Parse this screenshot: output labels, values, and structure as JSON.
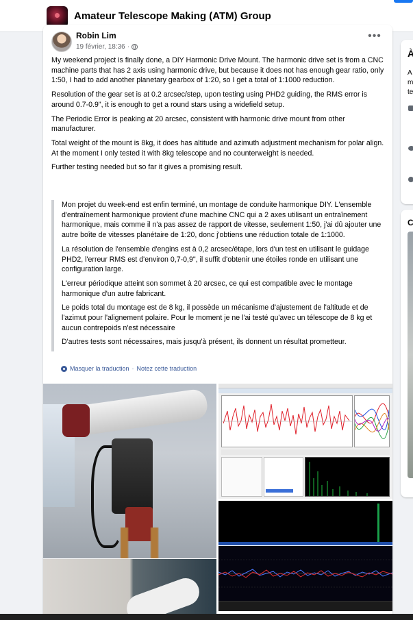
{
  "header": {
    "group_title": "Amateur Telescope Making (ATM) Group"
  },
  "post": {
    "author": "Robin Lim",
    "timestamp": "19 février, 18:36",
    "separator": "·",
    "more_label": "•••",
    "paragraphs": [
      "My weekend project is finally done, a DIY Harmonic Drive Mount. The harmonic drive set is from a CNC machine parts that has 2 axis using harmonic drive, but because it does not has enough gear ratio, only 1:50, I had to add another planetary gearbox of 1:20, so I get a total of 1:1000 reduction.",
      "Resolution of the gear set is at 0.2 arcsec/step, upon testing using PHD2 guiding, the RMS error is around 0.7-0.9\", it is enough to get a round stars using a widefield setup.",
      "The Periodic Error is peaking at 20 arcsec, consistent with harmonic drive mount from other manufacturer.",
      "Total weight of the mount is 8kg, it does has altitude and azimuth adjustment mechanism for polar align. At the moment I only tested it with 8kg telescope and no counterweight is needed.",
      "Further testing needed but so far it gives a promising result."
    ],
    "translation": [
      "Mon projet du week-end est enfin terminé, un montage de conduite harmonique DIY. L'ensemble d'entraînement harmonique provient d'une machine CNC qui a 2 axes utilisant un entraînement harmonique, mais comme il n'a pas assez de rapport de vitesse, seulement 1:50, j'ai dû ajouter une autre boîte de vitesses planétaire de 1:20, donc j'obtiens une réduction totale de 1:1000.",
      "La résolution de l'ensemble d'engins est à 0,2 arcsec/étape, lors d'un test en utilisant le guidage PHD2, l'erreur RMS est d'environ 0,7-0,9\", il suffit d'obtenir une étoiles ronde en utilisant une configuration large.",
      "L'erreur périodique atteint son sommet à 20 arcsec, ce qui est compatible avec le montage harmonique d'un autre fabricant.",
      "Le poids total du montage est de 8 kg, il possède un mécanisme d'ajustement de l'altitude et de l'azimut pour l'alignement polaire. Pour le moment je ne l'ai testé qu'avec un télescope de 8 kg et aucun contrepoids n'est nécessaire",
      "D'autres tests sont nécessaires, mais jusqu'à présent, ils donnent un résultat prometteur."
    ],
    "hide_translation": "Masquer la traduction",
    "rate_translation": "Notez cette traduction",
    "link_separator": " · "
  },
  "sidebar": {
    "title_partial": "À",
    "text_partial": "A\nm\nte",
    "section2_partial": "C"
  },
  "colors": {
    "link": "#385898",
    "accent": "#1877f2",
    "quote_bar": "#ced0d4"
  }
}
